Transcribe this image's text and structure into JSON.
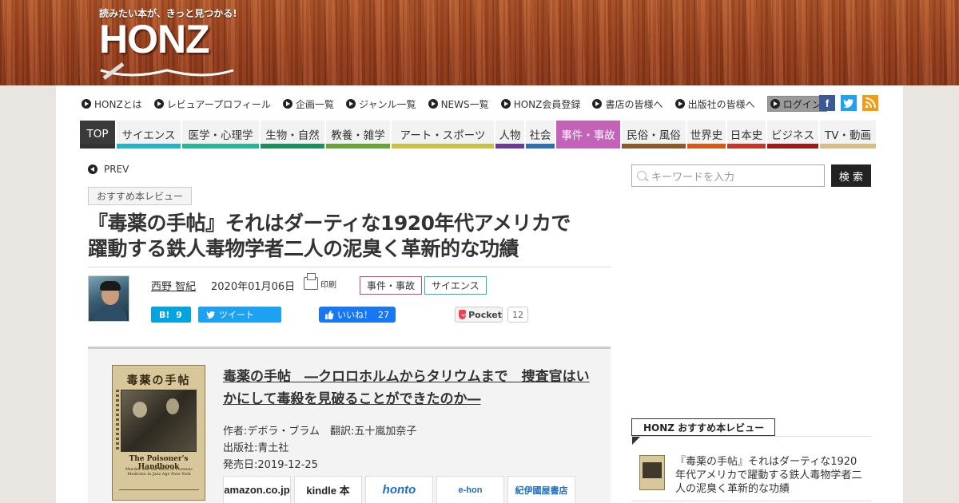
{
  "site": {
    "tagline": "読みたい本が、きっと見つかる!",
    "logo": "HONZ"
  },
  "top_nav": [
    {
      "label": "HONZとは"
    },
    {
      "label": "レビュアープロフィール"
    },
    {
      "label": "企画一覧"
    },
    {
      "label": "ジャンル一覧"
    },
    {
      "label": "NEWS一覧"
    },
    {
      "label": "HONZ会員登録"
    },
    {
      "label": "書店の皆様へ"
    },
    {
      "label": "出版社の皆様へ"
    },
    {
      "label": "ログイン"
    }
  ],
  "social_icons": [
    "facebook-icon",
    "twitter-icon",
    "rss-icon"
  ],
  "categories": [
    {
      "label": "TOP",
      "color": "#333333"
    },
    {
      "label": "サイエンス",
      "color": "#27b3c4"
    },
    {
      "label": "医学・心理学",
      "color": "#2bb597"
    },
    {
      "label": "生物・自然",
      "color": "#1d8f5c"
    },
    {
      "label": "教養・雑学",
      "color": "#6aa33a"
    },
    {
      "label": "アート・スポーツ",
      "color": "#c7c14a"
    },
    {
      "label": "人物",
      "color": "#6d3a91"
    },
    {
      "label": "社会",
      "color": "#2f6fb0"
    },
    {
      "label": "事件・事故",
      "color": "#c461b8"
    },
    {
      "label": "民俗・風俗",
      "color": "#8b5a2b"
    },
    {
      "label": "世界史",
      "color": "#d35a1a"
    },
    {
      "label": "日本史",
      "color": "#c0392b"
    },
    {
      "label": "ビジネス",
      "color": "#9b1b1b"
    },
    {
      "label": "TV・動画",
      "color": "#d9bd86"
    }
  ],
  "article": {
    "prev": "PREV",
    "category": "おすすめ本レビュー",
    "title_line1": "『毒薬の手帖』それはダーティな1920年代アメリカで",
    "title_line2": "躍動する鉄人毒物学者二人の泥臭く革新的な功績",
    "author": "西野 智紀",
    "date": "2020年01月06日",
    "print": "印刷",
    "tags": [
      "事件・事故",
      "サイエンス"
    ]
  },
  "share": {
    "hatena_label": "B!",
    "hatena_count": "9",
    "tweet": "ツイート",
    "like": "いいね！",
    "like_count": "27",
    "pocket": "Pocket",
    "pocket_count": "12"
  },
  "book": {
    "cover_title": "毒薬の手帖",
    "cover_en": "The Poisoner's Handbook",
    "cover_sub": "Murder and the Birth of Forensic Medicine in Jazz Age New York",
    "title": "毒薬の手帖　―クロロホルムからタリウムまで　捜査官はいかにして毒殺を見破ることができたのか―",
    "author": "作者:デボラ・ブラム　翻訳:五十嵐加奈子",
    "publisher": "出版社:青土社",
    "release": "発売日:2019-12-25",
    "shops": [
      "amazon.co.jp",
      "kindle 本",
      "honto",
      "e-hon",
      "紀伊國屋書店"
    ]
  },
  "sidebar": {
    "search_placeholder": "キーワードを入力",
    "search_button": "検 索",
    "rec_heading": "HONZ おすすめ本レビュー",
    "rec_title": "『毒薬の手帖』それはダーティな1920年代アメリカで躍動する鉄人毒物学者二人の泥臭く革新的な功績"
  }
}
